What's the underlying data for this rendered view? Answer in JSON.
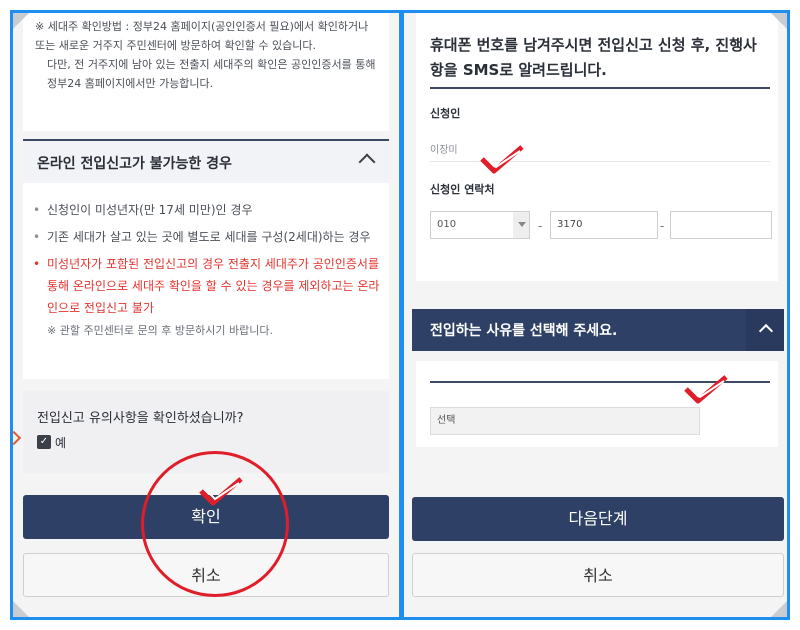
{
  "left": {
    "notice_line": "※ 세대주 확인방법 : 정부24 홈페이지(공인인증서 필요)에서 확인하거나 또는 새로운 거주지 주민센터에 방문하여 확인할 수 있습니다.",
    "notice_sub": "다만, 전 거주지에 남아 있는 전출지 세대주의 확인은 공인인증서를 통해 정부24 홈페이지에서만 가능합니다.",
    "section_title": "온라인 전입신고가 불가능한 경우",
    "conditions": [
      "신청인이 미성년자(만 17세 미만)인 경우",
      "기존 세대가 살고 있는 곳에 별도로 세대를 구성(2세대)하는 경우",
      "미성년자가 포함된 전입신고의 경우 전출지 세대주가 공인인증서를 통해 온라인으로 세대주 확인을 할 수 있는 경우를 제외하고는 온라인으로 전입신고 불가"
    ],
    "condition_note": "※ 관할 주민센터로 문의 후 방문하시기 바랍니다.",
    "confirm_question": "전입신고 유의사항을 확인하셨습니까?",
    "confirm_option": "예",
    "confirm_button": "확인",
    "cancel_button": "취소"
  },
  "right": {
    "message": "휴대폰 번호를 남겨주시면 전입신고 신청 후, 진행사항을 SMS로 알려드립니다.",
    "applicant_label": "신청인",
    "applicant_name": "이장미",
    "contact_label": "신청인 연락처",
    "phone_prefix": "010",
    "phone_mid": "3170",
    "phone_last": "",
    "dash": "-",
    "reason_title": "전입하는 사유를 선택해 주세요.",
    "reason_select": "선택",
    "next_button": "다음단계",
    "cancel_button": "취소"
  },
  "colors": {
    "navy": "#2f4066",
    "frame_blue": "#1e8ff0",
    "annotation_red": "#e01e2a",
    "warning_red": "#e3342f"
  }
}
